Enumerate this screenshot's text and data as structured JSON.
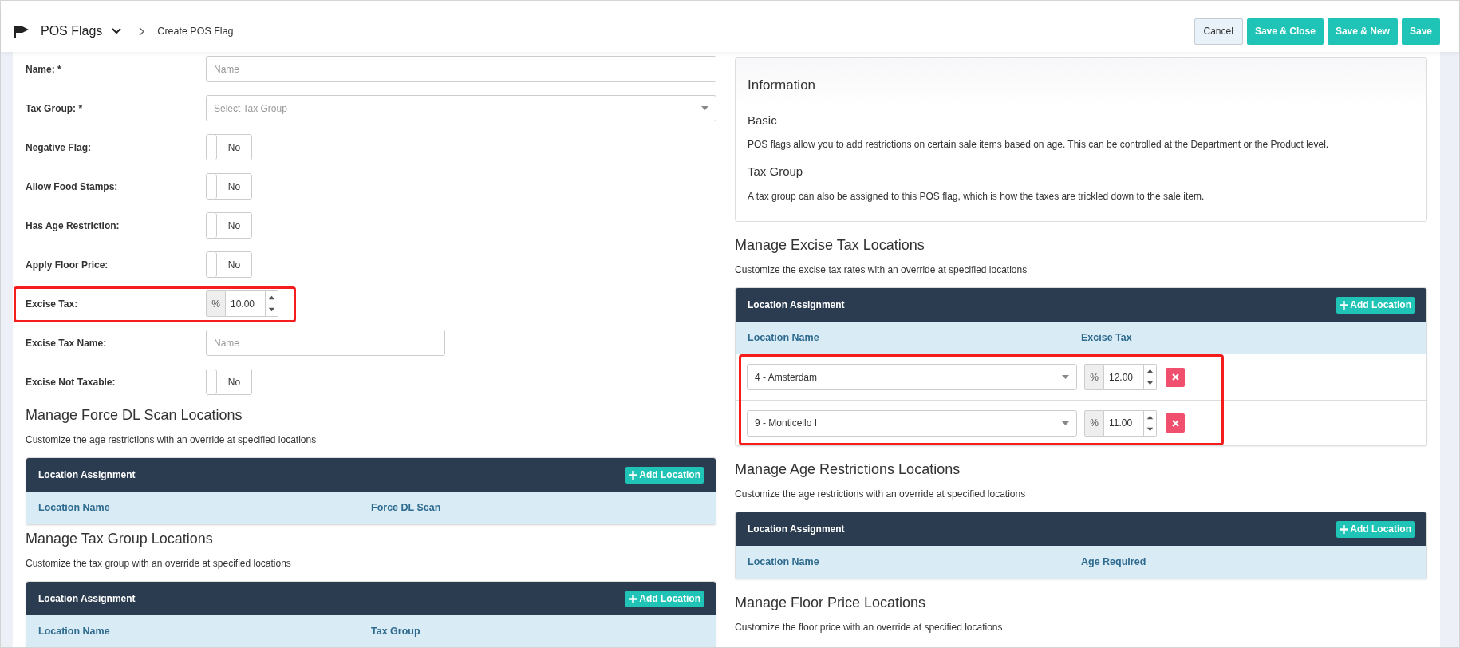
{
  "breadcrumb": {
    "module": "POS Flags",
    "page": "Create POS Flag"
  },
  "actions": [
    {
      "label": "Cancel",
      "kind": "secondary"
    },
    {
      "label": "Save & Close",
      "kind": "primary"
    },
    {
      "label": "Save & New",
      "kind": "primary"
    },
    {
      "label": "Save",
      "kind": "primary"
    }
  ],
  "form": {
    "fields": [
      {
        "label": "Name: *",
        "kind": "text",
        "placeholder": "Name"
      },
      {
        "label": "Tax Group: *",
        "kind": "select",
        "placeholder": "Select Tax Group"
      },
      {
        "label": "Negative Flag:",
        "kind": "toggle",
        "on": false,
        "text": "No"
      },
      {
        "label": "Allow Food Stamps:",
        "kind": "toggle",
        "on": false,
        "text": "No"
      },
      {
        "label": "Has Age Restriction:",
        "kind": "toggle",
        "on": false,
        "text": "No"
      },
      {
        "label": "Apply Floor Price:",
        "kind": "toggle",
        "on": false,
        "text": "No"
      },
      {
        "label": "Excise Tax:",
        "kind": "percent",
        "addon": "%",
        "value": "10.00",
        "highlighted": true
      },
      {
        "label": "Excise Tax Name:",
        "kind": "short_text",
        "placeholder": "Name"
      },
      {
        "label": "Excise Not Taxable:",
        "kind": "toggle",
        "on": false,
        "text": "No"
      }
    ]
  },
  "left_sections": [
    {
      "title": "Manage Force DL Scan Locations",
      "subtitle": "Customize the age restrictions with an override at specified locations",
      "panel": {
        "title": "Location Assignment",
        "button": "Add Location",
        "columns": [
          "Location Name",
          "Force DL Scan"
        ]
      }
    },
    {
      "title": "Manage Tax Group Locations",
      "subtitle": "Customize the tax group with an override at specified locations",
      "panel": {
        "title": "Location Assignment",
        "button": "Add Location",
        "columns": [
          "Location Name",
          "Tax Group"
        ]
      }
    }
  ],
  "info": {
    "title": "Information",
    "sections": [
      {
        "heading": "Basic",
        "text": "POS flags allow you to add restrictions on certain sale items based on age. This can be controlled at the Department or the Product level."
      },
      {
        "heading": "Tax Group",
        "text": "A tax group can also be assigned to this POS flag, which is how the taxes are trickled down to the sale item."
      }
    ]
  },
  "right_sections": [
    {
      "title": "Manage Excise Tax Locations",
      "subtitle": "Customize the excise tax rates with an override at specified locations",
      "panel": {
        "title": "Location Assignment",
        "button": "Add Location",
        "columns": [
          "Location Name",
          "Excise Tax"
        ],
        "rows_highlighted": true,
        "rows": [
          {
            "location": "4 - Amsterdam",
            "addon": "%",
            "value": "12.00"
          },
          {
            "location": "9 - Monticello I",
            "addon": "%",
            "value": "11.00"
          }
        ]
      }
    },
    {
      "title": "Manage Age Restrictions Locations",
      "subtitle": "Customize the age restrictions with an override at specified locations",
      "panel": {
        "title": "Location Assignment",
        "button": "Add Location",
        "columns": [
          "Location Name",
          "Age Required"
        ]
      }
    },
    {
      "title": "Manage Floor Price Locations",
      "subtitle": "Customize the floor price with an override at specified locations"
    }
  ]
}
